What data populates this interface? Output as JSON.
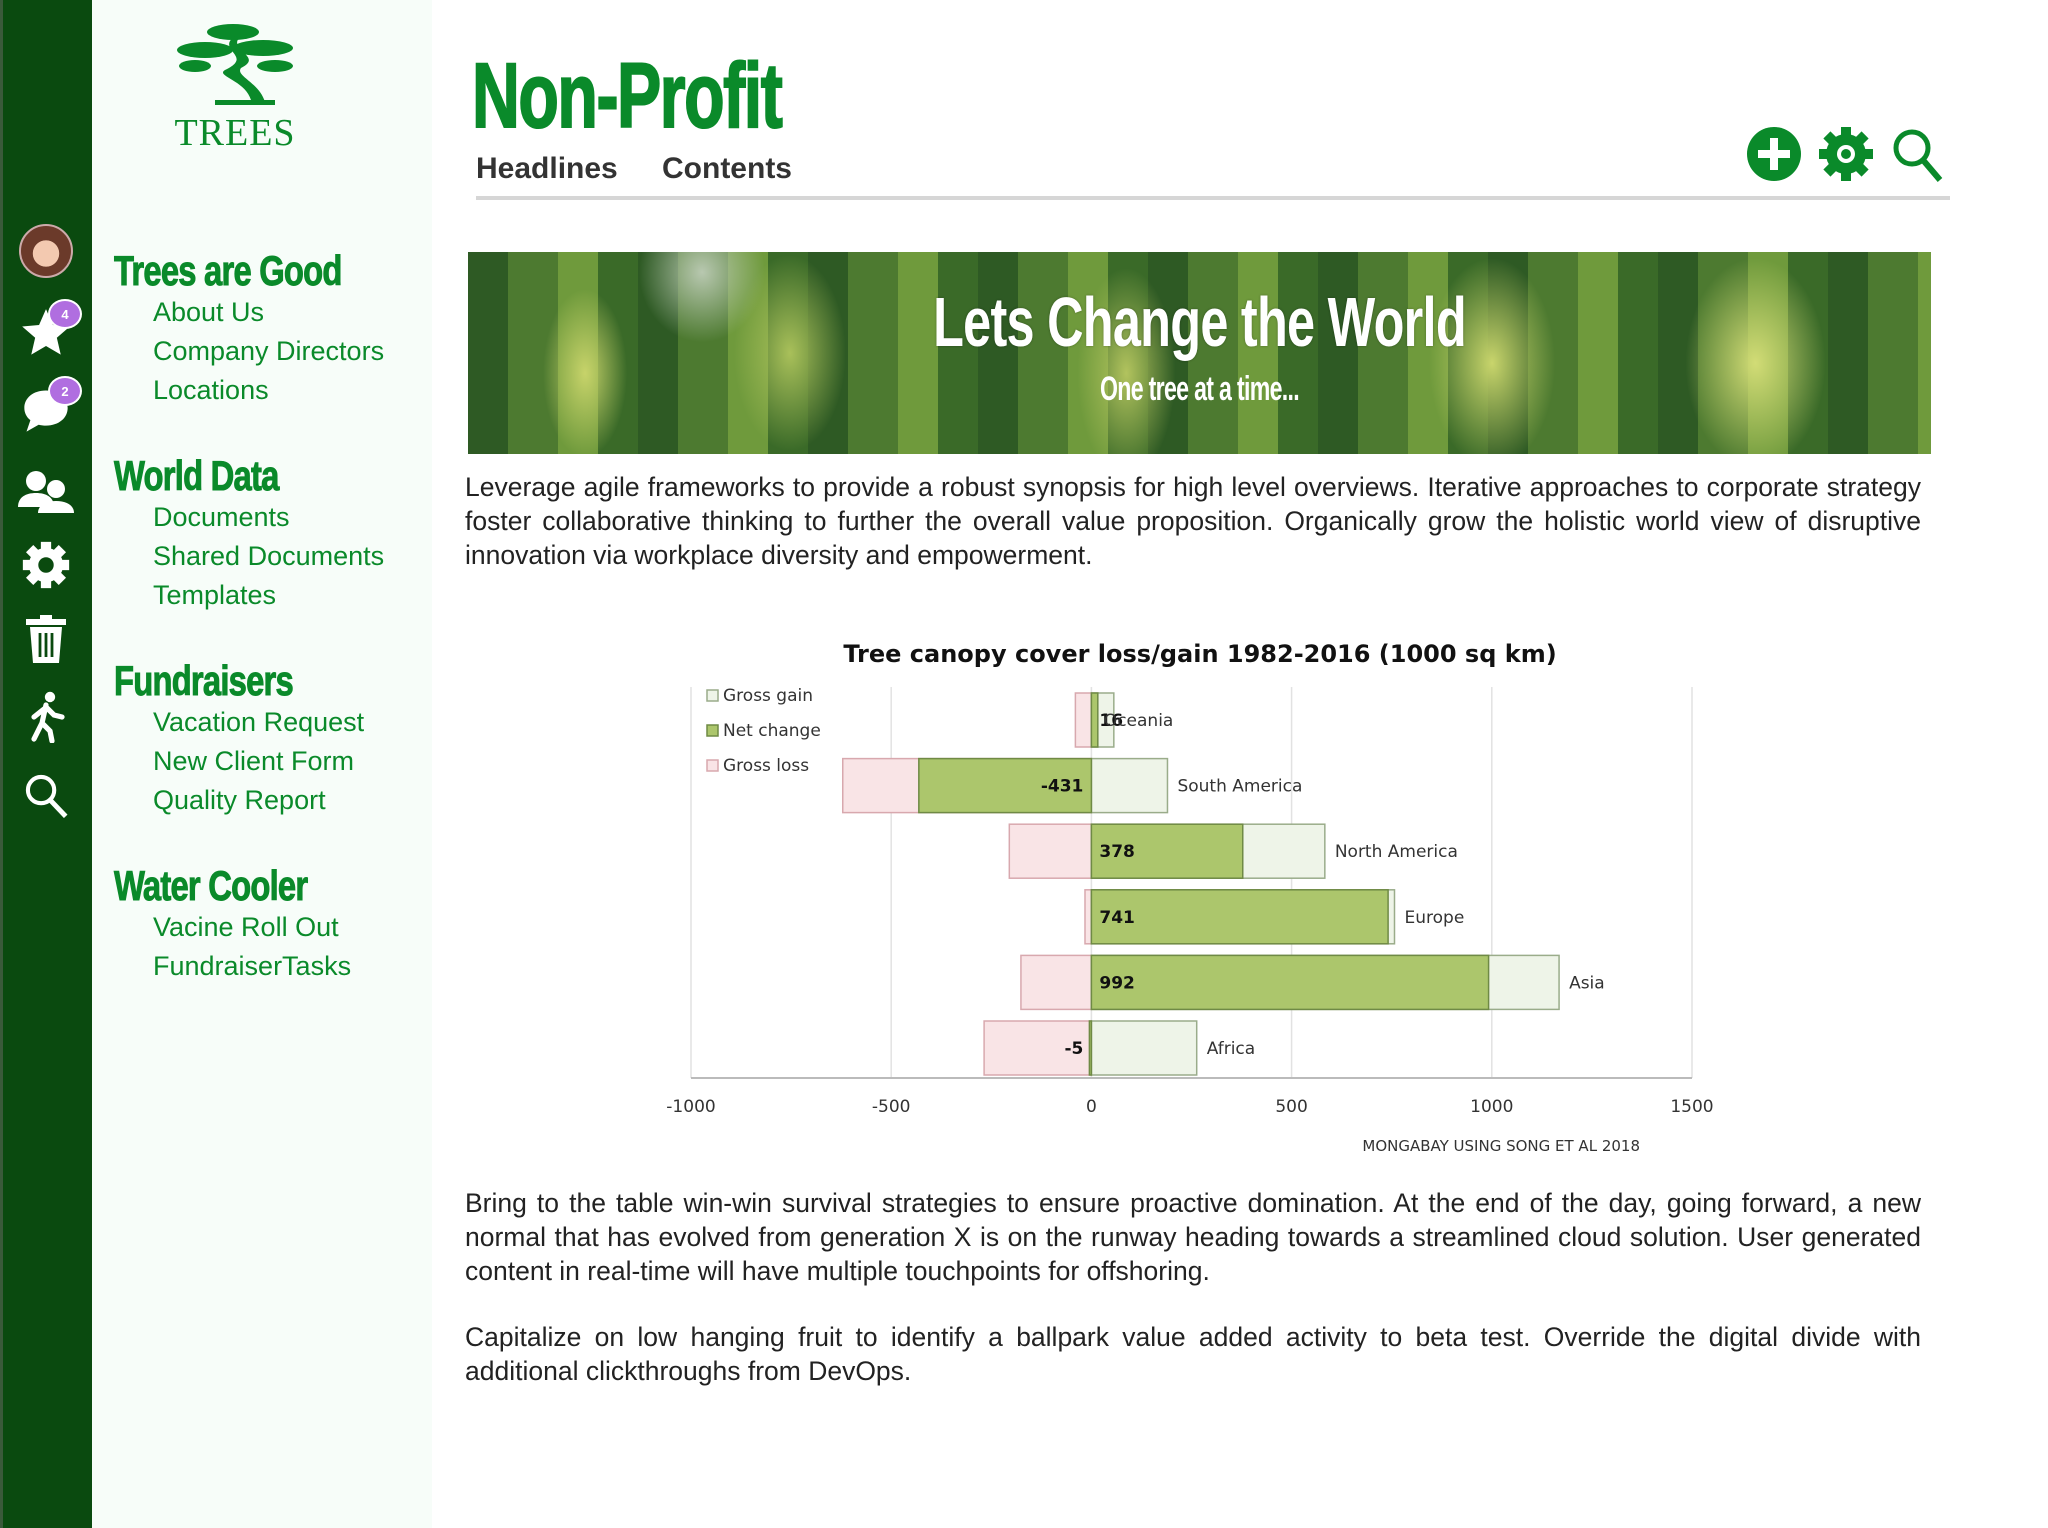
{
  "logo": {
    "text": "TREES"
  },
  "rail": {
    "items": [
      {
        "name": "avatar"
      },
      {
        "name": "star-icon",
        "badge": "4"
      },
      {
        "name": "chat-icon",
        "badge": "2"
      },
      {
        "name": "users-icon"
      },
      {
        "name": "gear-icon"
      },
      {
        "name": "trash-icon"
      },
      {
        "name": "walk-icon"
      },
      {
        "name": "search-icon"
      }
    ]
  },
  "nav": {
    "sections": [
      {
        "title": "Trees are Good",
        "items": [
          "About Us",
          "Company Directors",
          "Locations"
        ]
      },
      {
        "title": "World Data",
        "items": [
          "Documents",
          "Shared Documents",
          "Templates"
        ]
      },
      {
        "title": "Fundraisers",
        "items": [
          "Vacation Request",
          "New Client Form",
          "Quality Report"
        ]
      },
      {
        "title": "Water Cooler",
        "items": [
          "Vacine Roll Out",
          "FundraiserTasks"
        ]
      }
    ]
  },
  "header": {
    "title": "Non-Profit",
    "tabs": [
      "Headlines",
      "Contents"
    ],
    "icons": [
      "add-circle-icon",
      "gear-icon",
      "search-icon"
    ]
  },
  "colors": {
    "brand": "#0a8a2a",
    "rail": "#0a4a0f",
    "badge": "#b06ee0",
    "net": "#acc66c",
    "gain": "#eef4e8",
    "loss": "#f9e4e6"
  },
  "banner": {
    "headline": "Lets Change the World",
    "subhead": "One tree at a time..."
  },
  "paragraphs": [
    "Leverage agile frameworks to provide a robust synopsis for high level overviews. Iterative approaches to corporate strategy foster collaborative thinking to further the overall value proposition. Organically grow the holistic world view of disruptive innovation via workplace diversity and empowerment.",
    "Bring to the table win-win survival strategies to ensure proactive domination. At the end of the day, going forward, a new normal that has evolved from generation X is on the runway heading towards a streamlined cloud solution. User generated content in real-time will have multiple touchpoints for offshoring.",
    "Capitalize on low hanging fruit to identify a ballpark value added activity to beta test. Override the digital divide with additional clickthroughs from DevOps."
  ],
  "chart_data": {
    "type": "bar",
    "orientation": "horizontal",
    "title": "Tree canopy cover loss/gain 1982-2016 (1000 sq km)",
    "source": "MONGABAY USING SONG ET AL 2018",
    "categories": [
      "Oceania",
      "South America",
      "North America",
      "Europe",
      "Asia",
      "Africa"
    ],
    "series": [
      {
        "name": "Gross gain",
        "values": [
          56,
          190,
          583,
          757,
          1168,
          263
        ]
      },
      {
        "name": "Net change",
        "values": [
          16,
          -431,
          378,
          741,
          992,
          -5
        ]
      },
      {
        "name": "Gross loss",
        "values": [
          -40,
          -621,
          -205,
          -16,
          -176,
          -268
        ]
      }
    ],
    "data_labels": [
      "16",
      "-431",
      "378",
      "741",
      "992",
      "-5"
    ],
    "xlim": [
      -1000,
      1500
    ],
    "xticks": [
      "-1000",
      "-500",
      "0",
      "500",
      "1000",
      "1500"
    ],
    "grid": true,
    "legend": "top-left"
  }
}
